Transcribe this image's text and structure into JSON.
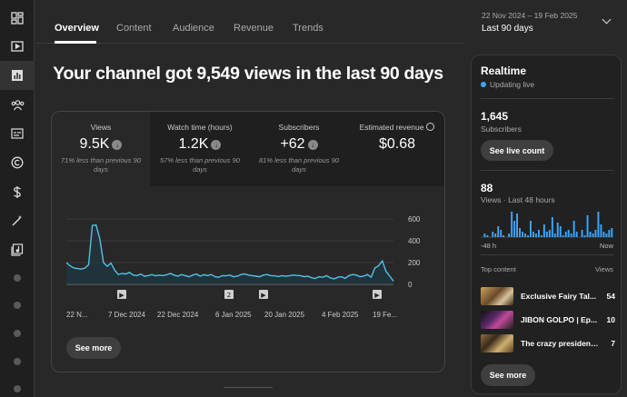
{
  "tabs": [
    {
      "label": "Overview",
      "active": true
    },
    {
      "label": "Content"
    },
    {
      "label": "Audience"
    },
    {
      "label": "Revenue"
    },
    {
      "label": "Trends"
    }
  ],
  "date_range": {
    "dates": "22 Nov 2024 – 19 Feb 2025",
    "label": "Last 90 days"
  },
  "headline": "Your channel got 9,549 views in the last 90 days",
  "metrics": [
    {
      "label": "Views",
      "value": "9.5K",
      "sub": "71% less than previous 90 days"
    },
    {
      "label": "Watch time (hours)",
      "value": "1.2K",
      "sub": "57% less than previous 90 days"
    },
    {
      "label": "Subscribers",
      "value": "+62",
      "sub": "81% less than previous 90 days"
    },
    {
      "label": "Estimated revenue",
      "value": "$0.68"
    }
  ],
  "chart_data": {
    "type": "area",
    "x_tick_labels": [
      "22 N...",
      "7 Dec 2024",
      "22 Dec 2024",
      "6 Jan 2025",
      "20 Jan 2025",
      "4 Feb 2025",
      "19 Fe..."
    ],
    "y_tick_labels": [
      "600",
      "400",
      "200",
      "0"
    ],
    "ylim": [
      0,
      650
    ],
    "values": [
      200,
      170,
      150,
      145,
      140,
      150,
      180,
      540,
      545,
      420,
      200,
      165,
      195,
      130,
      90,
      100,
      95,
      110,
      85,
      80,
      95,
      75,
      80,
      90,
      78,
      85,
      80,
      88,
      100,
      85,
      75,
      90,
      80,
      70,
      85,
      95,
      75,
      88,
      80,
      90,
      70,
      65,
      80,
      78,
      85,
      70,
      75,
      90,
      95,
      85,
      80,
      75,
      70,
      85,
      90,
      80,
      78,
      72,
      80,
      75,
      78,
      85,
      82,
      80,
      70,
      75,
      60,
      55,
      70,
      65,
      80,
      60,
      50,
      65,
      70,
      55,
      80,
      90,
      85,
      70,
      75,
      90,
      65,
      150,
      170,
      215,
      120,
      75,
      30
    ],
    "markers": [
      "▶",
      "2",
      "▶",
      "▶"
    ]
  },
  "see_more": "See more",
  "realtime": {
    "title": "Realtime",
    "live": "Updating live",
    "subscribers_value": "1,645",
    "subscribers_label": "Subscribers",
    "live_count_btn": "See live count",
    "views_value": "88",
    "views_label": "Views · Last 48 hours",
    "axis_left": "-48 h",
    "axis_right": "Now",
    "bars": [
      0,
      2,
      1,
      0,
      3,
      2,
      6,
      4,
      1,
      0,
      2,
      14,
      9,
      13,
      5,
      3,
      2,
      1,
      9,
      3,
      2,
      4,
      1,
      7,
      3,
      4,
      11,
      2,
      8,
      6,
      1,
      3,
      4,
      2,
      9,
      3,
      0,
      4,
      1,
      12,
      3,
      2,
      4,
      14,
      7,
      3,
      2,
      4,
      5
    ],
    "top_content_label": "Top content",
    "top_views_label": "Views",
    "top_content": [
      {
        "title": "Exclusive Fairy Tal...",
        "views": "54"
      },
      {
        "title": "JIBON GOLPO | Ep...",
        "views": "10"
      },
      {
        "title": "The crazy president...",
        "views": "7"
      }
    ],
    "see_more": "See more"
  },
  "colors": {
    "accent": "#3ea6ff",
    "line": "#4fc3e8",
    "fill": "#1e3a48"
  },
  "rail_icons": [
    "dashboard-icon",
    "content-icon",
    "analytics-icon",
    "community-icon",
    "subtitles-icon",
    "copyright-icon",
    "earn-icon",
    "customization-icon",
    "audio-library-icon"
  ]
}
